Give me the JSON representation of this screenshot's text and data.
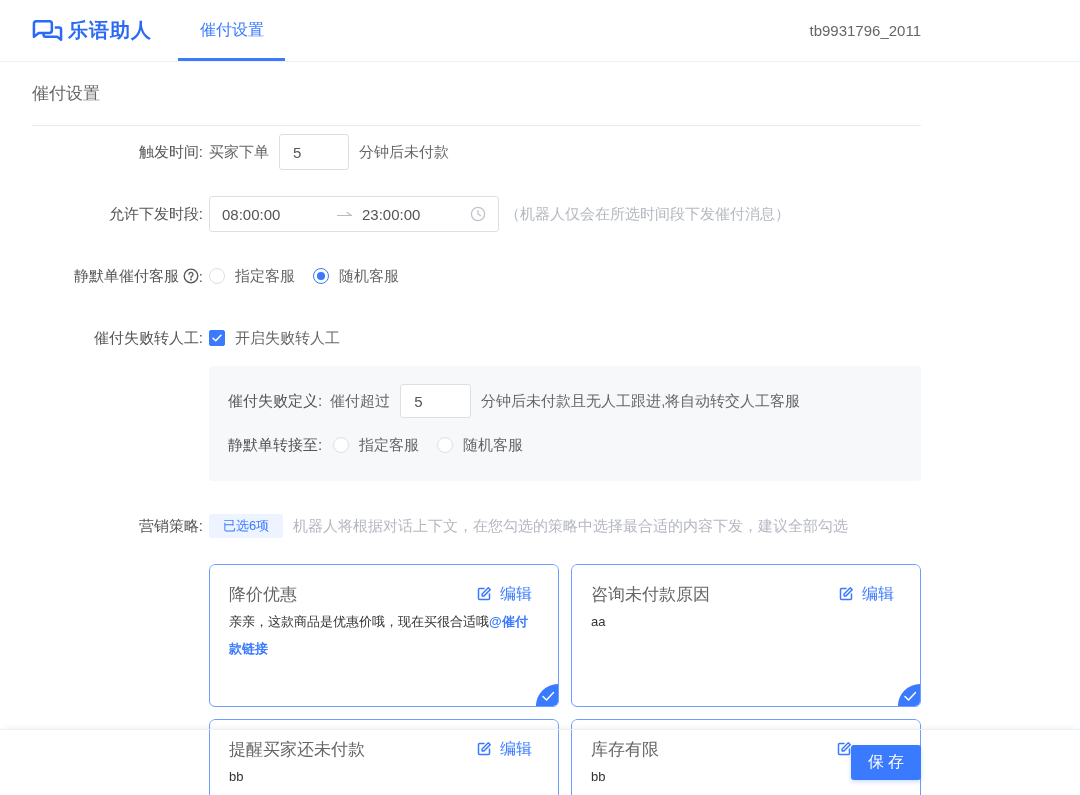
{
  "header": {
    "logo": "乐语助人",
    "tabs": [
      {
        "label": "催付设置",
        "selected": true
      }
    ],
    "user": "tb9931796_2011"
  },
  "page_title": "催付设置",
  "form": {
    "trigger": {
      "label": "触发时间:",
      "prefix": "买家下单",
      "value": "5",
      "suffix": "分钟后未付款"
    },
    "time_range": {
      "label": "允许下发时段:",
      "start": "08:00:00",
      "end": "23:00:00",
      "hint": "（机器人仅会在所选时间段下发催付消息）"
    },
    "silent_agent": {
      "label": "静默单催付客服",
      "help": true,
      "colon": ":",
      "options": [
        {
          "label": "指定客服",
          "selected": false
        },
        {
          "label": "随机客服",
          "selected": true
        }
      ]
    },
    "fail_transfer": {
      "label": "催付失败转人工:",
      "checkbox": {
        "label": "开启失败转人工",
        "checked": true
      },
      "panel": {
        "definition": {
          "label": "催付失败定义:",
          "prefix": "催付超过",
          "value": "5",
          "suffix": "分钟后未付款且无人工跟进,将自动转交人工客服"
        },
        "transfer_to": {
          "label": "静默单转接至:",
          "options": [
            {
              "label": "指定客服",
              "selected": false
            },
            {
              "label": "随机客服",
              "selected": false
            }
          ]
        }
      }
    },
    "marketing": {
      "label": "营销策略:",
      "tag": "已选6项",
      "hint": "机器人将根据对话上下文，在您勾选的策略中选择最合适的内容下发，建议全部勾选",
      "cards": [
        {
          "title": "降价优惠",
          "edit": "编辑",
          "body": "亲亲，这款商品是优惠价哦，现在买很合适哦**@催付款链接**",
          "selected": true
        },
        {
          "title": "咨询未付款原因",
          "edit": "编辑",
          "body": "aa",
          "selected": true
        },
        {
          "title": "提醒买家还未付款",
          "edit": "编辑",
          "body": "bb",
          "selected": true
        },
        {
          "title": "库存有限",
          "body": "bb",
          "selected": true
        }
      ]
    }
  },
  "save_button": "保存"
}
